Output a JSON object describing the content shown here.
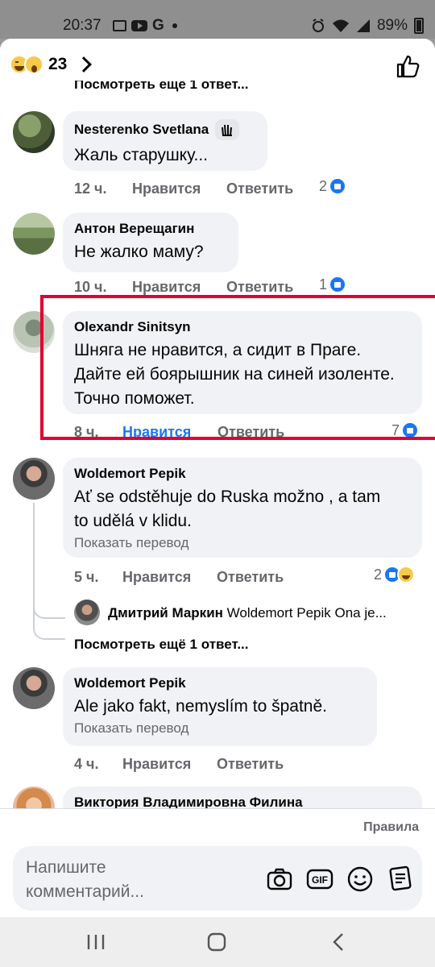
{
  "status_bar": {
    "time": "20:37",
    "battery": "89%"
  },
  "header": {
    "reaction_count": "23"
  },
  "partial_top_text": "Посмотреть ещё 1 ответ...",
  "comments": [
    {
      "author": "Nesterenko Svetlana",
      "text": "Жаль старушку...",
      "time": "12 ч.",
      "like": "Нравится",
      "reply": "Ответить",
      "reactions": "2"
    },
    {
      "author": "Антон Верещагин",
      "text": "Не жалко маму?",
      "time": "10 ч.",
      "like": "Нравится",
      "reply": "Ответить",
      "reactions": "1"
    },
    {
      "author": "Olexandr Sinitsyn",
      "text": "Шняга не нравится, а сидит в Праге. Дайте ей боярышник на синей изоленте. Точно поможет.",
      "time": "8 ч.",
      "like": "Нравится",
      "reply": "Ответить",
      "reactions": "7"
    },
    {
      "author": "Woldemort Pepik",
      "text": "Ať se odstěhuje do Ruska možno , a tam to udělá v klidu.",
      "translate": "Показать перевод",
      "time": "5 ч.",
      "like": "Нравится",
      "reply": "Ответить",
      "reactions": "2"
    },
    {
      "author": "Woldemort Pepik",
      "text": "Ale jako fakt, nemyslím to špatně.",
      "translate": "Показать перевод",
      "time": "4 ч.",
      "like": "Нравится",
      "reply": "Ответить"
    },
    {
      "author": "Виктория Владимировна Филина"
    }
  ],
  "reply_preview": {
    "author": "Дмитрий Маркин",
    "text": "Woldemort Pepik Ona je..."
  },
  "more_replies": "Посмотреть ещё 1 ответ...",
  "footer": {
    "rules": "Правила",
    "placeholder": "Напишите комментарий...",
    "gif": "GIF"
  }
}
